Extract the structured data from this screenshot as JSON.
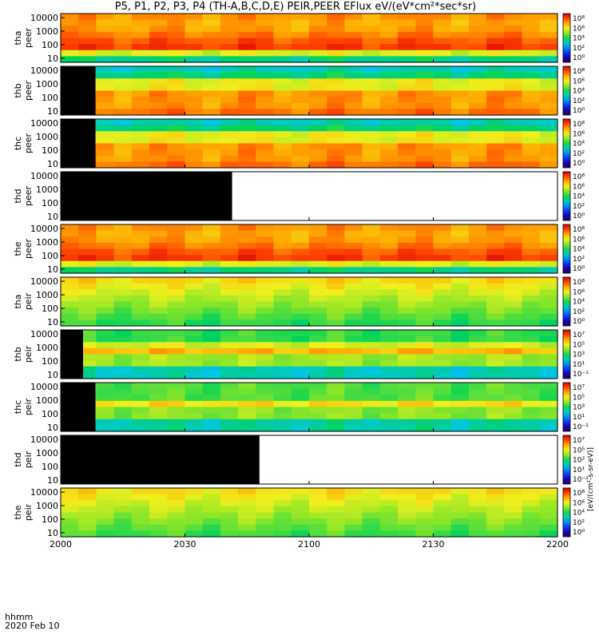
{
  "title": "P5, P1, P2, P3, P4 (TH-A,B,C,D,E) PEIR,PEER EFlux eV/(eV*cm²*sec*sr)",
  "footer": {
    "unit": "hhmm",
    "date": "2020 Feb 10"
  },
  "colorbar_label": "[eV/(cm²-s-sr-eV)]",
  "chart_data": {
    "type": "heatmap",
    "x_ticks": [
      "2000",
      "2030",
      "2100",
      "2130",
      "2200"
    ],
    "x_range": [
      "2000",
      "2200"
    ],
    "y_scale": "log",
    "y_range": [
      5,
      20000
    ],
    "y_ticks": [
      "10000",
      "1000",
      "100",
      "10"
    ],
    "panels": [
      {
        "label_top": "tha",
        "label_bottom": "peer",
        "cb_ticks": [
          "10⁸",
          "10⁶",
          "10⁴",
          "10²",
          "10⁰"
        ],
        "profile": "peer_hot",
        "black_until": 0,
        "white_from": null
      },
      {
        "label_top": "thb",
        "label_bottom": "peer",
        "cb_ticks": [
          "10⁸",
          "10⁶",
          "10⁴",
          "10²",
          "10⁰"
        ],
        "profile": "peer_std",
        "black_until": 0.07,
        "white_from": null
      },
      {
        "label_top": "thc",
        "label_bottom": "peer",
        "cb_ticks": [
          "10⁸",
          "10⁶",
          "10⁴",
          "10²",
          "10⁰"
        ],
        "profile": "peer_std",
        "black_until": 0.07,
        "white_from": null
      },
      {
        "label_top": "thd",
        "label_bottom": "peer",
        "cb_ticks": [
          "10⁸",
          "10⁶",
          "10⁴",
          "10²",
          "10⁰"
        ],
        "profile": "none",
        "black_until": 0.345,
        "white_from": 0.345
      },
      {
        "label_top": "the",
        "label_bottom": "peer",
        "cb_ticks": [
          "10⁸",
          "10⁶",
          "10⁴",
          "10²",
          "10⁰"
        ],
        "profile": "peer_hot",
        "black_until": 0,
        "white_from": null
      },
      {
        "label_top": "tha",
        "label_bottom": "peir",
        "cb_ticks": [
          "10⁸",
          "10⁶",
          "10⁴",
          "10²",
          "10⁰"
        ],
        "profile": "peir_a",
        "black_until": 0,
        "white_from": null
      },
      {
        "label_top": "thb",
        "label_bottom": "peir",
        "cb_ticks": [
          "10⁷",
          "10⁵",
          "10³",
          "10¹",
          "10⁻¹"
        ],
        "profile": "peir_b",
        "black_until": 0.045,
        "white_from": null
      },
      {
        "label_top": "thc",
        "label_bottom": "peir",
        "cb_ticks": [
          "10⁷",
          "10⁵",
          "10³",
          "10¹",
          "10⁻¹"
        ],
        "profile": "peir_c",
        "black_until": 0.07,
        "white_from": null
      },
      {
        "label_top": "thd",
        "label_bottom": "peir",
        "cb_ticks": [
          "10⁷",
          "10⁵",
          "10³",
          "10¹",
          "10⁻¹"
        ],
        "profile": "none",
        "black_until": 0.4,
        "white_from": 0.4
      },
      {
        "label_top": "the",
        "label_bottom": "peir",
        "cb_ticks": [
          "10⁸",
          "10⁶",
          "10⁴",
          "10²",
          "10⁰"
        ],
        "profile": "peir_e",
        "black_until": 0,
        "white_from": null
      }
    ]
  }
}
